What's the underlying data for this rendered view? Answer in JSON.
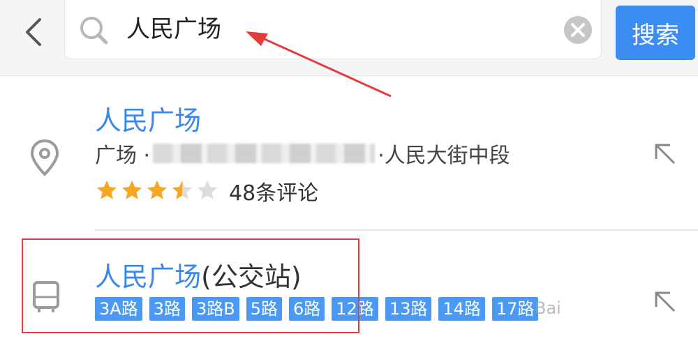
{
  "search": {
    "query": "人民广场",
    "button_label": "搜索"
  },
  "results": [
    {
      "title": "人民广场",
      "category": "广场 ·",
      "address_suffix": "·人民大街中段",
      "rating_stars": 3.5,
      "reviews": "48条评论"
    },
    {
      "title": "人民广场",
      "suffix": "(公交站)",
      "routes": [
        "3A路",
        "3路",
        "3路B",
        "5路",
        "6路",
        "12路",
        "13路",
        "14路",
        "17路"
      ]
    }
  ],
  "watermark": "Bai",
  "colors": {
    "accent": "#3b8cf3",
    "title_blue": "#3a86ea",
    "star": "#f5a623",
    "annotation_red": "#e53b3b"
  },
  "icons": [
    "back-arrow-icon",
    "search-icon",
    "clear-icon",
    "location-pin-icon",
    "bus-icon",
    "navigate-arrow-icon"
  ]
}
